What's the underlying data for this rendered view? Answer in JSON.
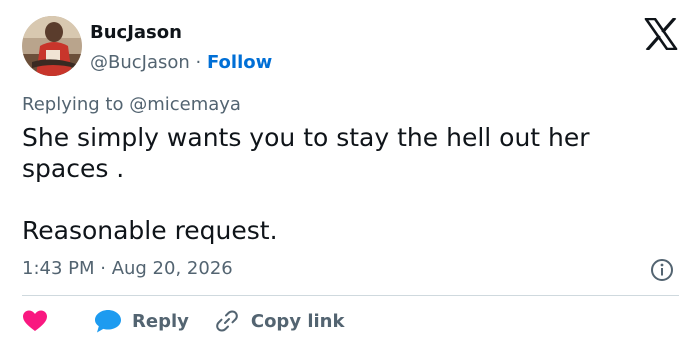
{
  "author": {
    "display_name": "BucJason",
    "handle": "@BucJason",
    "separator": " · ",
    "follow_label": "Follow"
  },
  "reply_context": {
    "prefix": "Replying to ",
    "mention": "@micemaya"
  },
  "tweet": {
    "text": "She simply wants you to stay the hell out her spaces .\n\nReasonable request.",
    "timestamp": "1:43 PM · Aug 20, 2026"
  },
  "actions": {
    "reply_label": "Reply",
    "copy_link_label": "Copy link"
  },
  "icons": {
    "brand": "x-logo-icon",
    "info": "info-icon",
    "like": "heart-icon",
    "reply": "speech-bubble-icon",
    "copy_link": "link-icon"
  },
  "colors": {
    "like": "#f91880",
    "reply": "#1d9bf0",
    "follow": "#006fd6",
    "muted": "#536471"
  }
}
